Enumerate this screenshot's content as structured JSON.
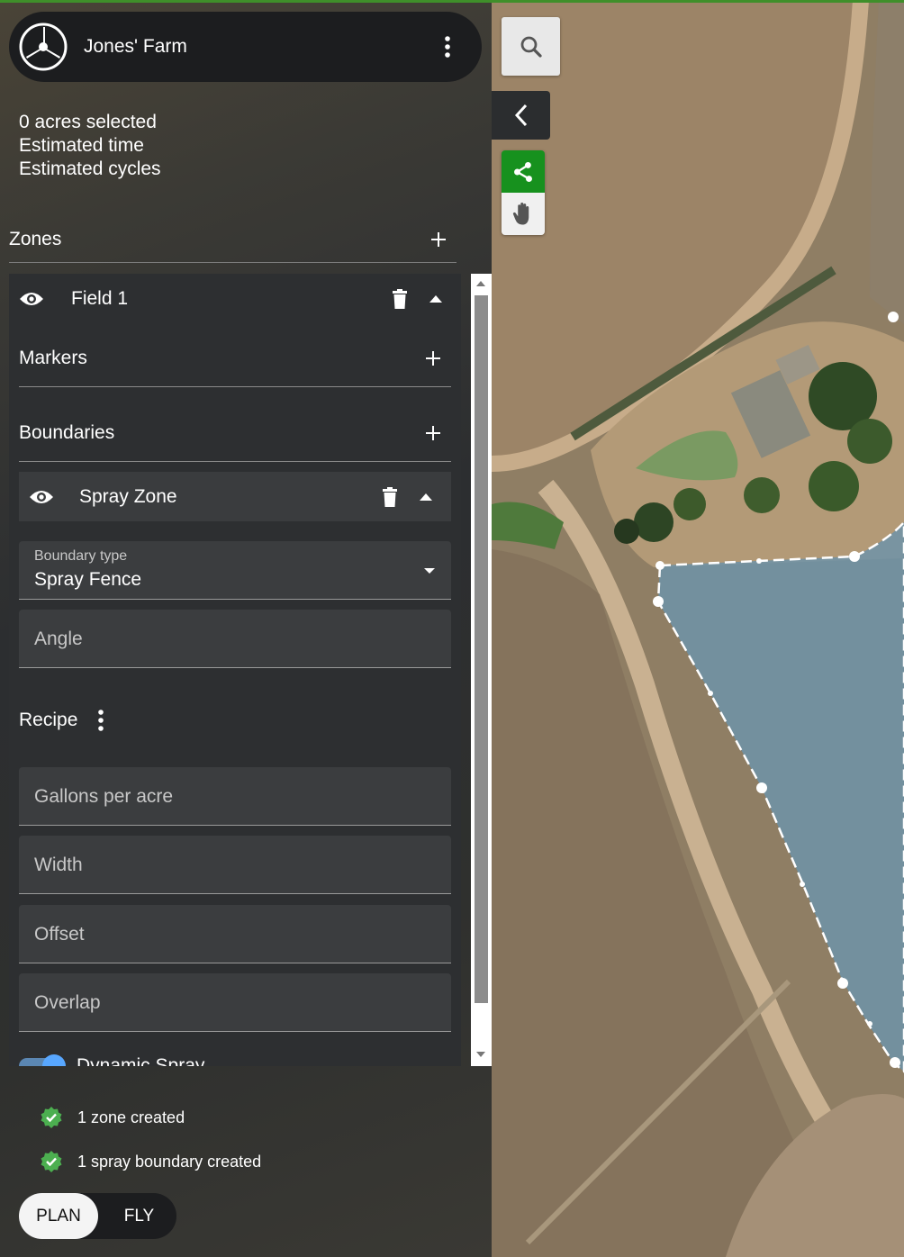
{
  "header": {
    "farm_name": "Jones' Farm"
  },
  "stats": {
    "acres": "0 acres selected",
    "time": "Estimated time",
    "cycles": "Estimated cycles"
  },
  "zones": {
    "title": "Zones",
    "field": {
      "name": "Field 1",
      "markers_label": "Markers",
      "boundaries_label": "Boundaries",
      "zone": {
        "name": "Spray Zone",
        "boundary_type_label": "Boundary type",
        "boundary_type_value": "Spray Fence",
        "angle_placeholder": "Angle"
      },
      "recipe": {
        "title": "Recipe",
        "gallons_placeholder": "Gallons per acre",
        "width_placeholder": "Width",
        "offset_placeholder": "Offset",
        "overlap_placeholder": "Overlap",
        "dynamic_spray_label": "Dynamic Spray",
        "dynamic_spray_on": true
      }
    }
  },
  "status": [
    {
      "text": "1 zone created",
      "icon": "check-badge-icon"
    },
    {
      "text": "1 spray boundary created",
      "icon": "check-badge-icon"
    }
  ],
  "mode": {
    "plan": "PLAN",
    "fly": "FLY",
    "selected": "PLAN"
  },
  "colors": {
    "accent_green": "#17911e",
    "check_green": "#4caf50",
    "toggle_blue": "#58a7ff",
    "spray_zone_fill": "#6f93a8"
  },
  "map_tools": {
    "search": "search-icon",
    "collapse": "chevron-left-icon",
    "tools": [
      "polygon-draw-icon",
      "hand-pan-icon"
    ],
    "active_tool": "polygon-draw-icon"
  }
}
